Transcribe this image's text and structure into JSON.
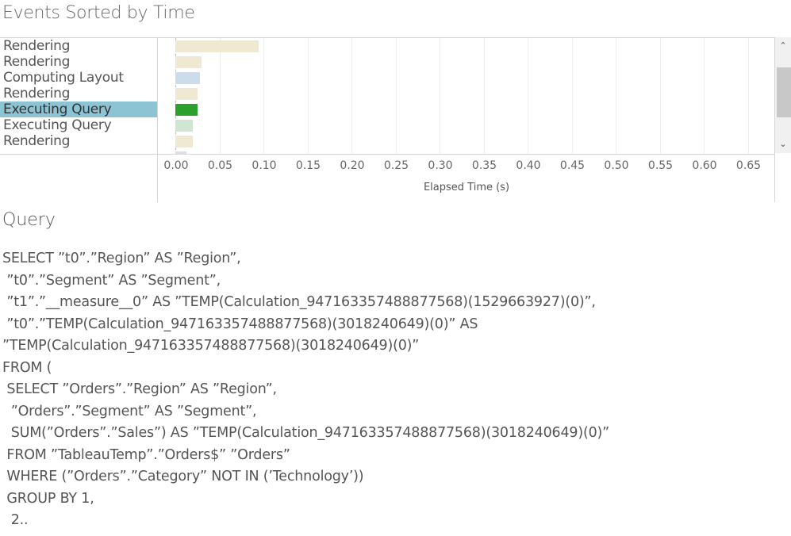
{
  "header": {
    "title": "Events Sorted by Time"
  },
  "chart_data": {
    "type": "bar",
    "orientation": "horizontal",
    "title": "Events Sorted by Time",
    "xlabel": "Elapsed Time (s)",
    "ylabel": "",
    "xlim": [
      0,
      0.7
    ],
    "x_ticks": [
      "0.00",
      "0.05",
      "0.10",
      "0.15",
      "0.20",
      "0.25",
      "0.30",
      "0.35",
      "0.40",
      "0.45",
      "0.50",
      "0.55",
      "0.60",
      "0.65"
    ],
    "grid": true,
    "categories": [
      "Rendering",
      "Rendering",
      "Computing Layout",
      "Rendering",
      "Executing Query",
      "Executing Query",
      "Rendering"
    ],
    "values": [
      0.095,
      0.03,
      0.028,
      0.025,
      0.025,
      0.02,
      0.02
    ],
    "selected_index": 4,
    "partial_bottom_value": 0.013,
    "colors": {
      "Rendering": "#f0e9d2",
      "Computing Layout": "#cddceb",
      "Executing Query": "#d0e6d2",
      "Executing Query (selected)": "#2ca02c",
      "partial": "#e2dced",
      "selection_highlight": "#8cc4d3"
    }
  },
  "scrollbar": {
    "up_icon": "⌃",
    "down_icon": "⌄"
  },
  "query": {
    "title": "Query",
    "lines": [
      "SELECT ”t0”.”Region” AS ”Region”,",
      " ”t0”.”Segment” AS ”Segment”,",
      " ”t1”.”__measure__0” AS ”TEMP(Calculation_947163357488877568)(1529663927)(0)”,",
      " ”t0”.”TEMP(Calculation_947163357488877568)(3018240649)(0)” AS",
      "”TEMP(Calculation_947163357488877568)(3018240649)(0)”",
      "FROM (",
      " SELECT ”Orders”.”Region” AS ”Region”,",
      "  ”Orders”.”Segment” AS ”Segment”,",
      "  SUM(”Orders”.”Sales”) AS ”TEMP(Calculation_947163357488877568)(3018240649)(0)”",
      " FROM ”TableauTemp”.”Orders$” ”Orders”",
      " WHERE (”Orders”.”Category” NOT IN (’Technology’))",
      " GROUP BY 1,",
      "  2.."
    ]
  }
}
